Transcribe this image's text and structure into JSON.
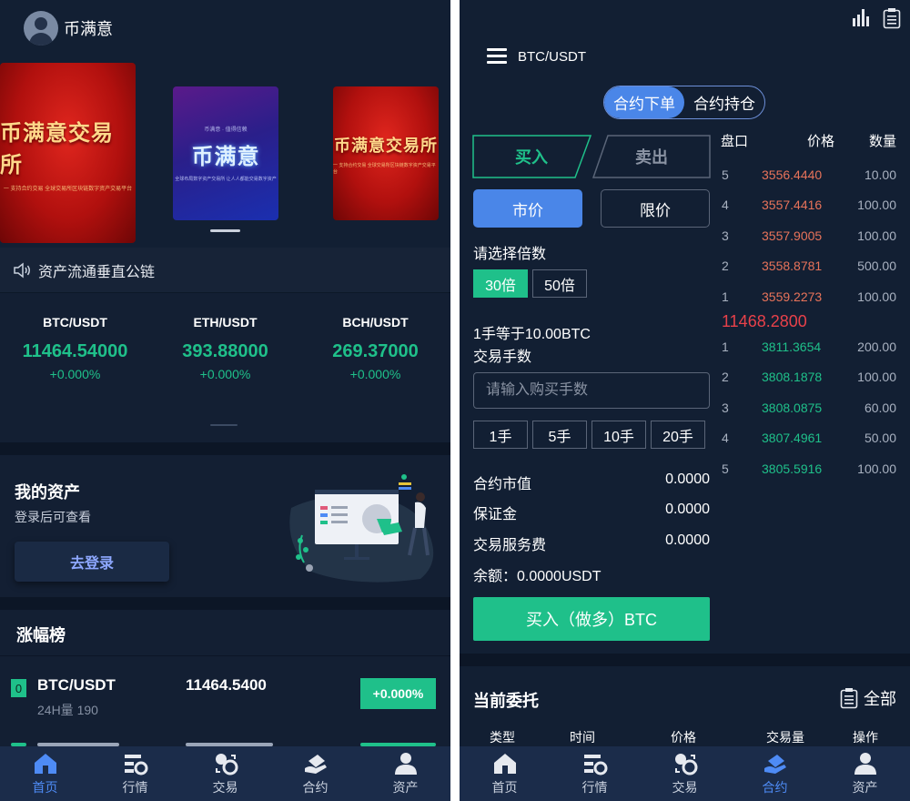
{
  "left": {
    "app_title": "币满意",
    "banners": [
      {
        "title": "币满意交易所",
        "sub": "一 支持合约交易 全球交易所区块链数字资产交易平台"
      },
      {
        "title": "币满意",
        "top": "币满意 · 值得信赖",
        "sub": "全球布局数字资产交易所 让人人都能交易数字资产"
      },
      {
        "title": "币满意交易所",
        "sub": "一 支持合约交易 全球交易所区块链数字资产交易平台"
      }
    ],
    "notice": "资产流通垂直公链",
    "tickers": [
      {
        "pair": "BTC/USDT",
        "price": "11464.54000",
        "change": "+0.000%"
      },
      {
        "pair": "ETH/USDT",
        "price": "393.88000",
        "change": "+0.000%"
      },
      {
        "pair": "BCH/USDT",
        "price": "269.37000",
        "change": "+0.000%"
      }
    ],
    "assets": {
      "title": "我的资产",
      "subtitle": "登录后可查看",
      "login_label": "去登录"
    },
    "gainers": {
      "title": "涨幅榜",
      "rows": [
        {
          "rank": "0",
          "pair": "BTC/USDT",
          "volume": "24H量 190",
          "price": "11464.5400",
          "change": "+0.000%"
        }
      ]
    },
    "tabbar": [
      {
        "label": "首页",
        "icon": "home-icon",
        "active": true
      },
      {
        "label": "行情",
        "icon": "market-icon",
        "active": false
      },
      {
        "label": "交易",
        "icon": "trade-icon",
        "active": false
      },
      {
        "label": "合约",
        "icon": "contract-icon",
        "active": false
      },
      {
        "label": "资产",
        "icon": "user-icon",
        "active": false
      }
    ],
    "accent": "#4e8bf5",
    "green": "#1fc08a"
  },
  "right": {
    "pair_title": "BTC/USDT",
    "segments": [
      "合约下单",
      "合约持仓"
    ],
    "buy_tab": "买入",
    "sell_tab": "卖出",
    "market_label": "市价",
    "limit_label": "限价",
    "leverage_label": "请选择倍数",
    "leverage_options": [
      "30倍",
      "50倍"
    ],
    "lot_info": "1手等于10.00BTC",
    "lots_label": "交易手数",
    "lots_placeholder": "请输入购买手数",
    "lot_buttons": [
      "1手",
      "5手",
      "10手",
      "20手"
    ],
    "stats": [
      {
        "label": "合约市值",
        "value": "0.0000"
      },
      {
        "label": "保证金",
        "value": "0.0000"
      },
      {
        "label": "交易服务费",
        "value": "0.0000"
      }
    ],
    "balance": "余额：0.0000USDT",
    "buy_button": "买入（做多）BTC",
    "orderbook": {
      "headers": [
        "盘口",
        "价格",
        "数量"
      ],
      "asks": [
        {
          "idx": "5",
          "price": "3556.4440",
          "qty": "10.00"
        },
        {
          "idx": "4",
          "price": "3557.4416",
          "qty": "100.00"
        },
        {
          "idx": "3",
          "price": "3557.9005",
          "qty": "100.00"
        },
        {
          "idx": "2",
          "price": "3558.8781",
          "qty": "500.00"
        },
        {
          "idx": "1",
          "price": "3559.2273",
          "qty": "100.00"
        }
      ],
      "last_price": "11468.2800",
      "bids": [
        {
          "idx": "1",
          "price": "3811.3654",
          "qty": "200.00"
        },
        {
          "idx": "2",
          "price": "3808.1878",
          "qty": "100.00"
        },
        {
          "idx": "3",
          "price": "3808.0875",
          "qty": "60.00"
        },
        {
          "idx": "4",
          "price": "3807.4961",
          "qty": "50.00"
        },
        {
          "idx": "5",
          "price": "3805.5916",
          "qty": "100.00"
        }
      ]
    },
    "orders": {
      "title": "当前委托",
      "all_label": "全部",
      "headers": [
        "类型",
        "时间",
        "价格",
        "交易量",
        "操作"
      ]
    },
    "tabbar": [
      {
        "label": "首页",
        "icon": "home-icon",
        "active": false
      },
      {
        "label": "行情",
        "icon": "market-icon",
        "active": false
      },
      {
        "label": "交易",
        "icon": "trade-icon",
        "active": false
      },
      {
        "label": "合约",
        "icon": "contract-icon",
        "active": true
      },
      {
        "label": "资产",
        "icon": "user-icon",
        "active": false
      }
    ],
    "ask_color": "#e8735a",
    "bid_color": "#1fc08a",
    "last_price_color": "#e8414a"
  }
}
